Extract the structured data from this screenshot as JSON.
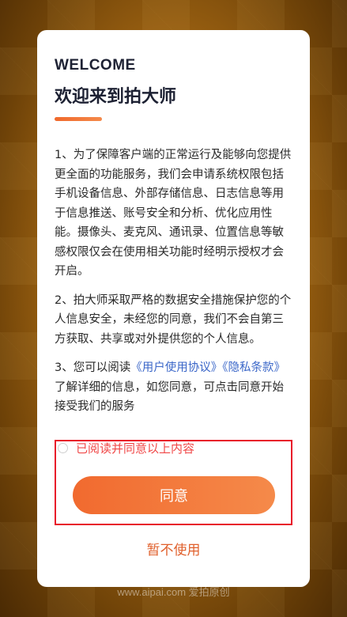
{
  "dialog": {
    "welcome": "WELCOME",
    "title": "欢迎来到拍大师",
    "paragraph1": "1、为了保障客户端的正常运行及能够向您提供更全面的功能服务，我们会申请系统权限包括手机设备信息、外部存储信息、日志信息等用于信息推送、账号安全和分析、优化应用性能。摄像头、麦克风、通讯录、位置信息等敏感权限仅会在使用相关功能时经明示授权才会开启。",
    "paragraph2": "2、拍大师采取严格的数据安全措施保护您的个人信息安全，未经您的同意，我们不会自第三方获取、共享或对外提供您的个人信息。",
    "paragraph3_prefix": "3、您可以阅读",
    "user_agreement_link": "《用户使用协议》",
    "privacy_link": "《隐私条款》",
    "paragraph3_suffix": "了解详细的信息，如您同意，可点击同意开始接受我们的服务",
    "agree_checkbox_label": "已阅读并同意以上内容",
    "agree_button": "同意",
    "decline_button": "暂不使用"
  },
  "watermark": "www.aipai.com 爱拍原创",
  "colors": {
    "accent": "#f16a2f",
    "link": "#3a66c8",
    "agree_text": "#f04848",
    "highlight_box": "#e8182a"
  }
}
